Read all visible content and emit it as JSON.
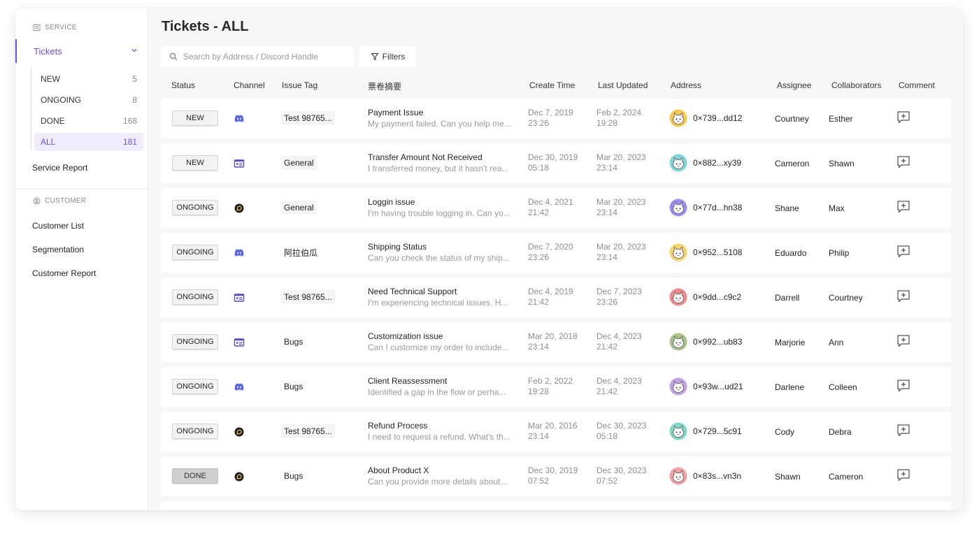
{
  "sidebar": {
    "service_section": "SERVICE",
    "tickets_label": "Tickets",
    "sub_items": [
      {
        "label": "NEW",
        "count": "5"
      },
      {
        "label": "ONGOING",
        "count": "8"
      },
      {
        "label": "DONE",
        "count": "168"
      },
      {
        "label": "ALL",
        "count": "181"
      }
    ],
    "service_report": "Service Report",
    "customer_section": "CUSTOMER",
    "customer_list": "Customer List",
    "segmentation": "Segmentation",
    "customer_report": "Customer Report"
  },
  "main": {
    "title": "Tickets - ALL",
    "search_placeholder": "Search by Address / Discord Handle",
    "filters_label": "Filters",
    "columns": {
      "status": "Status",
      "channel": "Channel",
      "issue_tag": "Issue Tag",
      "summary": "票卷摘要",
      "create_time": "Create Time",
      "last_updated": "Last Updated",
      "address": "Address",
      "assignee": "Assignee",
      "collaborators": "Collaborators",
      "comment": "Comment"
    },
    "rows": [
      {
        "status": "NEW",
        "channel": "discord-icon",
        "tag": "Test 98765...",
        "subject": "Payment Issue",
        "preview": "My payment failed. Can you help me...",
        "created_date": "Dec 7, 2019",
        "created_time": "23:26",
        "updated_date": "Feb 2, 2024",
        "updated_time": "19:28",
        "address": "0×739...dd12",
        "avatar_color": "#f6c94c",
        "assignee": "Courtney",
        "collaborator": "Esther"
      },
      {
        "status": "NEW",
        "channel": "card-icon",
        "tag": "General",
        "subject": "Transfer Amount Not Received",
        "preview": "I transferred money, but it hasn't rea...",
        "created_date": "Dec 30, 2019",
        "created_time": "05:18",
        "updated_date": "Mar 20, 2023",
        "updated_time": "23:14",
        "address": "0×882...xy39",
        "avatar_color": "#7fd6d9",
        "assignee": "Cameron",
        "collaborator": "Shawn"
      },
      {
        "status": "ONGOING",
        "channel": "chat-bubble-icon",
        "tag": "General",
        "subject": "Loggin issue",
        "preview": "I'm having trouble logging in. Can yo...",
        "created_date": "Dec 4, 2021",
        "created_time": "21:42",
        "updated_date": "Mar 20, 2023",
        "updated_time": "23:14",
        "address": "0×77d...hn38",
        "avatar_color": "#9b8cf0",
        "assignee": "Shane",
        "collaborator": "Max"
      },
      {
        "status": "ONGOING",
        "channel": "discord-icon",
        "tag": "阿拉伯瓜",
        "subject": "Shipping Status",
        "preview": "Can you check the status of my ship...",
        "created_date": "Dec 7, 2020",
        "created_time": "23:26",
        "updated_date": "Mar 20, 2023",
        "updated_time": "23:14",
        "address": "0×952...5108",
        "avatar_color": "#f8d26a",
        "assignee": "Eduardo",
        "collaborator": "Philip"
      },
      {
        "status": "ONGOING",
        "channel": "card-icon",
        "tag": "Test 98765...",
        "subject": "Need Technical Support",
        "preview": "I'm experiencing technical issues. H...",
        "created_date": "Dec 4, 2019",
        "created_time": "21:42",
        "updated_date": "Dec 7, 2023",
        "updated_time": "23:26",
        "address": "0×9dd...c9c2",
        "avatar_color": "#f08a8a",
        "assignee": "Darrell",
        "collaborator": "Courtney"
      },
      {
        "status": "ONGOING",
        "channel": "card-icon",
        "tag": "Bugs",
        "subject": "Customization issue",
        "preview": "Can I customize my order to include...",
        "created_date": "Mar 20, 2018",
        "created_time": "23:14",
        "updated_date": "Dec 4, 2023",
        "updated_time": "21:42",
        "address": "0×992...ub83",
        "avatar_color": "#a6c48a",
        "assignee": "Marjorie",
        "collaborator": "Ann"
      },
      {
        "status": "ONGOING",
        "channel": "discord-icon",
        "tag": "Bugs",
        "subject": "Client Reassessment",
        "preview": "Identified a gap in the flow or perha...",
        "created_date": "Feb 2, 2022",
        "created_time": "19:28",
        "updated_date": "Dec 4, 2023",
        "updated_time": "21:42",
        "address": "0×93w...ud21",
        "avatar_color": "#c3a0e6",
        "assignee": "Darlene",
        "collaborator": "Colleen"
      },
      {
        "status": "ONGOING",
        "channel": "chat-bubble-icon",
        "tag": "Test 98765...",
        "subject": "Refund Process",
        "preview": "I need to request a refund. What's th...",
        "created_date": "Mar 20, 2016",
        "created_time": "23:14",
        "updated_date": "Dec 30, 2023",
        "updated_time": "05:18",
        "address": "0×729...5c91",
        "avatar_color": "#7fd6c8",
        "assignee": "Cody",
        "collaborator": "Debra"
      },
      {
        "status": "DONE",
        "channel": "chat-bubble-icon",
        "tag": "Bugs",
        "subject": "About Product X",
        "preview": "Can you provide more details about...",
        "created_date": "Dec 30, 2019",
        "created_time": "07:52",
        "updated_date": "Dec 30, 2023",
        "updated_time": "07:52",
        "address": "0×83s...vn3n",
        "avatar_color": "#f0a0a0",
        "assignee": "Shawn",
        "collaborator": "Cameron"
      }
    ]
  },
  "colors": {
    "accent": "#6c4cf0",
    "discord": "#5865f2",
    "card": "#5b47d6"
  }
}
